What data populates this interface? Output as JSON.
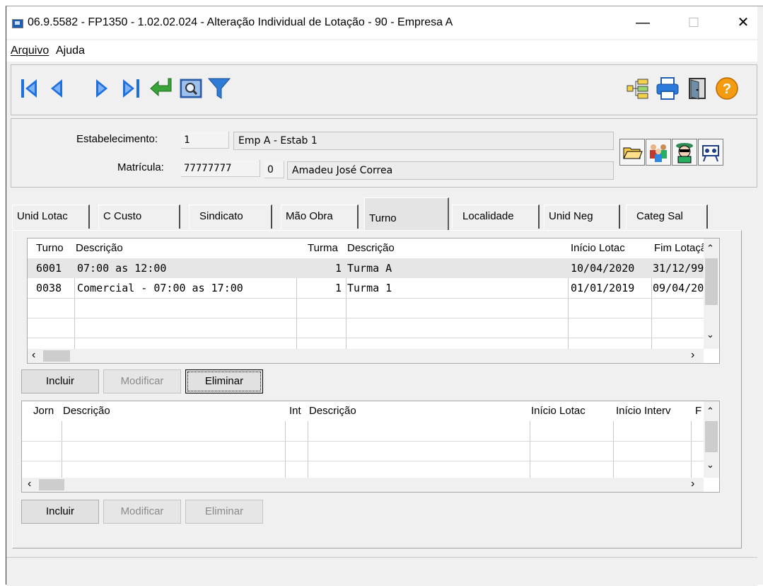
{
  "window": {
    "title": "06.9.5582 - FP1350 - 1.02.02.024 - Alteração Individual de Lotação - 90 - Empresa A",
    "minimize_glyph": "—",
    "maximize_glyph": "☐",
    "close_glyph": "✕"
  },
  "menu": {
    "arquivo": "Arquivo",
    "ajuda": "Ajuda"
  },
  "toolbar": {
    "icons": [
      "first-record-icon",
      "previous-record-icon",
      "next-record-icon",
      "last-record-icon",
      "enter-icon",
      "zoom-icon",
      "filter-icon",
      "tree-icon",
      "print-icon",
      "exit-door-icon",
      "help-icon"
    ],
    "colors": {
      "nav_blue": "#1f6fe0",
      "enter_green": "#3aa33a",
      "help_orange": "#f39c12",
      "filter_blue": "#2e7cd6"
    }
  },
  "header": {
    "estabelecimento_label": "Estabelecimento:",
    "estabelecimento_code": "1",
    "estabelecimento_name": "Emp A - Estab 1",
    "matricula_label": "Matrícula:",
    "matricula_code": "77777777",
    "matricula_digit": "0",
    "matricula_name": "Amadeu José Correa",
    "side_icons": [
      "open-folder-icon",
      "people-icon",
      "agent-icon",
      "video-icon"
    ]
  },
  "tabs": [
    "Unid Lotac",
    "C Custo",
    "Sindicato",
    "Mão Obra",
    "Turno",
    "Localidade",
    "Unid Neg",
    "Categ Sal"
  ],
  "active_tab": "Turno",
  "turnos_grid": {
    "headers": [
      "Turno",
      "Descrição",
      "Turma",
      "Descrição",
      "Início Lotac",
      "Fim Lotaçã"
    ],
    "rows": [
      [
        "6001",
        "07:00 as 12:00",
        "1",
        "Turma A",
        "10/04/2020",
        "31/12/99"
      ],
      [
        "0038",
        "Comercial - 07:00 as 17:00",
        "1",
        "Turma 1",
        "01/01/2019",
        "09/04/20"
      ]
    ]
  },
  "turnos_buttons": {
    "incluir": "Incluir",
    "modificar": "Modificar",
    "eliminar": "Eliminar"
  },
  "jornadas_grid": {
    "headers": [
      "Jorn",
      "Descrição",
      "Int",
      "Descrição",
      "Início Lotac",
      "Início Interv",
      "F"
    ]
  },
  "jornadas_buttons": {
    "incluir": "Incluir",
    "modificar": "Modificar",
    "eliminar": "Eliminar"
  }
}
